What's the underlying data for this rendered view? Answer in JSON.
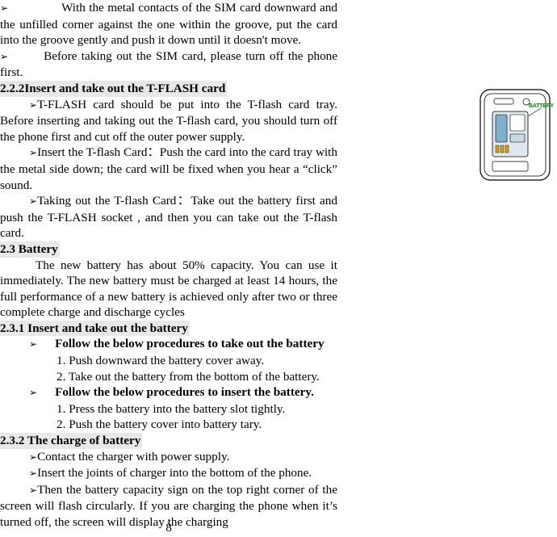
{
  "document": {
    "page_number": "8",
    "paragraphs": [
      {
        "id": "p1",
        "bullet": "➢",
        "text": "With the metal contacts of the SIM card downward and the unfilled corner against the one within the groove, put the card into the groove gently and push it down until it doesn't move."
      },
      {
        "id": "p2",
        "bullet": "➢",
        "text": "Before taking out the SIM card, please turn off the phone first."
      }
    ],
    "sections": [
      {
        "id": "sec-2-2-2",
        "heading": "2.2.2Insert and take out the T-FLASH card",
        "items": [
          {
            "bullet": "➢",
            "text": "T-FLASH card should be put into the T-flash card tray. Before inserting and taking out the T-flash card, you should turn off the phone first and cut off the outer power supply."
          },
          {
            "bullet": "➢",
            "text": "Insert the T-flash Card：Push the card into the card tray with the metal side down; the card will be fixed when you hear a “click” sound."
          },
          {
            "bullet": "➢",
            "text": "Taking out the T-flash Card：Take out the battery first and push the T-FLASH socket , and then you can take out the T-flash card."
          }
        ]
      },
      {
        "id": "sec-2-3",
        "heading": "2.3 Battery",
        "body": "The new battery has about 50% capacity. You can use it immediately. The new battery must be charged at least 14 hours, the full performance of a new battery is achieved only after two or three complete charge and discharge cycles"
      },
      {
        "id": "sec-2-3-1",
        "heading": "2.3.1 Insert and take out the battery",
        "groups": [
          {
            "bullet": "➢",
            "title": "Follow the below procedures to take out the battery",
            "steps": [
              "1. Push downward the battery cover away.",
              "2. Take out the battery from the bottom of the battery."
            ]
          },
          {
            "bullet": "➢",
            "title": "Follow the below procedures to insert the battery.",
            "steps": [
              "1. Press the battery into the battery slot tightly.",
              "2. Push the battery cover into battery tary."
            ]
          }
        ]
      },
      {
        "id": "sec-2-3-2",
        "heading": "2.3.2 The charge of battery",
        "items": [
          {
            "bullet": "➢",
            "text": "Contact the charger with power supply."
          },
          {
            "bullet": "➢",
            "text": "Insert the joints of charger into the bottom of the phone."
          },
          {
            "bullet": "➢",
            "text": "Then the battery capacity sign on the top right corner of the screen will flash circularly. If you are charging the phone when it’s turned off, the screen will display the charging"
          }
        ]
      }
    ],
    "figure": {
      "name": "phone-back-battery-diagram",
      "label": "BATTERY",
      "label_color": "#1a7a1a"
    }
  }
}
